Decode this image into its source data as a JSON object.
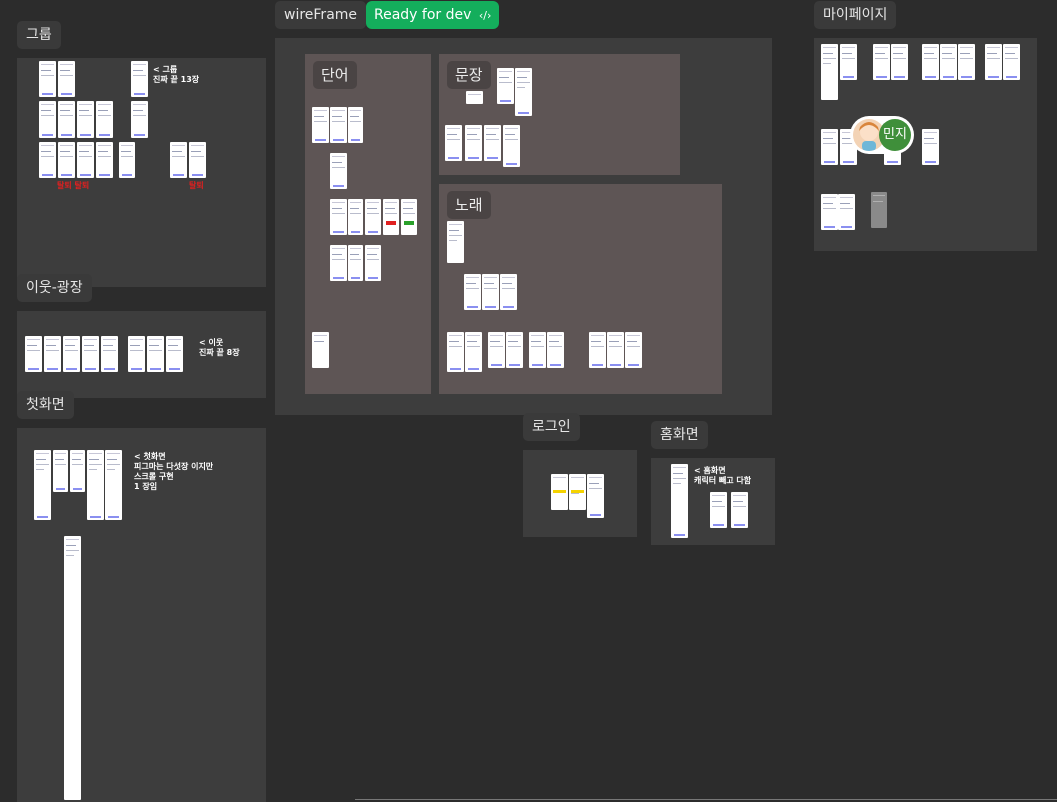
{
  "canvas": {
    "background": "#2c2c2c"
  },
  "header": {
    "page_label": "wireFrame",
    "ready_label": "Ready for dev",
    "ready_icon": "code-icon",
    "ready_color": "#14ae5c"
  },
  "sections": {
    "group": {
      "label": "그룹",
      "note_line1": "< 그룹",
      "note_line2": "진짜 끝 13장",
      "red_left": "탈퇴 탈퇴",
      "red_right": "탈퇴"
    },
    "neighbor": {
      "label": "이웃-광장",
      "note_line1": "< 이웃",
      "note_line2": "진짜 끝 8장"
    },
    "first_screen": {
      "label": "첫화면",
      "note_line1": "< 첫화면",
      "note_line2": "피그마는 다섯장 이지만",
      "note_line3": "스크롤 구현",
      "note_line4": "1 장임"
    },
    "word": {
      "label": "단어"
    },
    "sentence": {
      "label": "문장"
    },
    "song": {
      "label": "노래"
    },
    "login": {
      "label": "로그인"
    },
    "home": {
      "label": "홈화면",
      "note_line1": "< 홈화면",
      "note_line2": "캐릭터 빼고 다함"
    },
    "mypage": {
      "label": "마이페이지"
    }
  },
  "collaborators": {
    "avatar_user": "민지",
    "avatar_user_color": "#3f8f3a"
  }
}
